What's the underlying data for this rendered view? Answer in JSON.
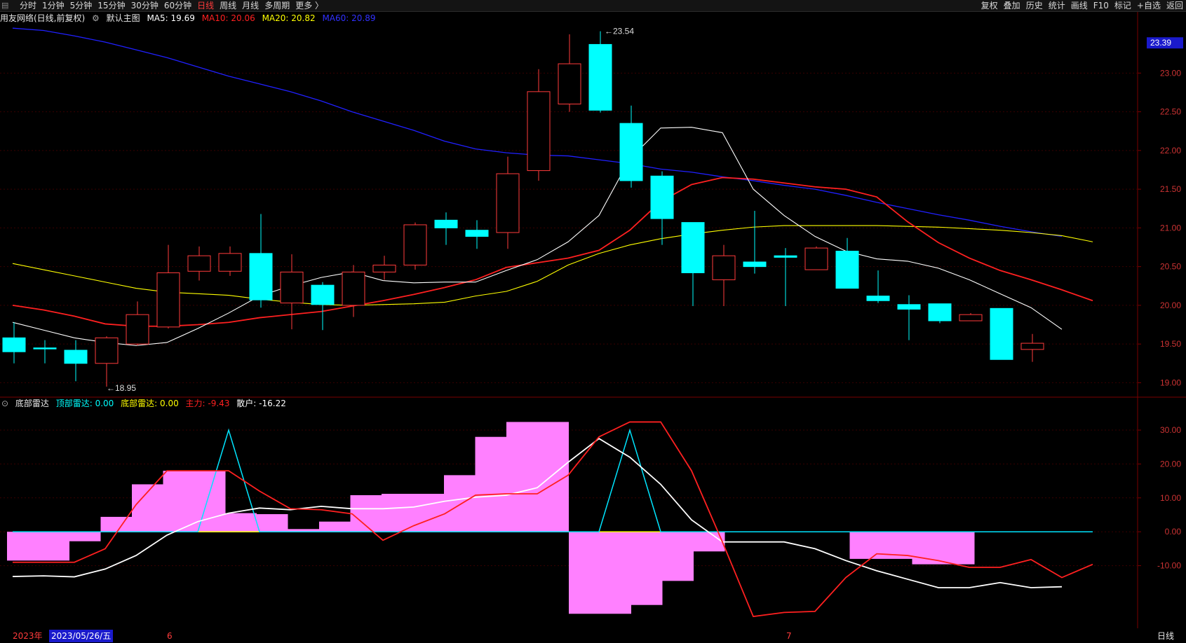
{
  "toolbar": {
    "left_items": [
      "分时",
      "1分钟",
      "5分钟",
      "15分钟",
      "30分钟",
      "60分钟",
      "日线",
      "周线",
      "月线",
      "多周期",
      "更多 〉"
    ],
    "active_item": "日线",
    "right_items": [
      "复权",
      "叠加",
      "历史",
      "统计",
      "画线",
      "F10",
      "标记",
      "+自选",
      "返回"
    ]
  },
  "main_info": {
    "stock": "用友网络(日线,前复权)",
    "template": "默认主图",
    "ma5_label": "MA5: 19.69",
    "ma10_label": "MA10: 20.06",
    "ma20_label": "MA20: 20.82",
    "ma60_label": "MA60: 20.89"
  },
  "indicator_info": {
    "name": "底部雷达",
    "top_label": "顶部雷达: 0.00",
    "bottom_label": "底部雷达: 0.00",
    "main_label": "主力: -9.43",
    "retail_label": "散户: -16.22"
  },
  "annotations": {
    "high": "23.54",
    "low": "18.95",
    "last_price": "23.39"
  },
  "date_bar": {
    "year": "2023年",
    "selected_date": "2023/05/26/五",
    "month_june": "6",
    "month_july": "7",
    "period": "日线"
  },
  "colors": {
    "up": "#ff3b3b",
    "down": "#00ffff",
    "ma5": "#ffffff",
    "ma10": "#ff2020",
    "ma20": "#ffff00",
    "ma60": "#2020ff",
    "hist": "#ff80ff"
  },
  "chart_data": [
    {
      "type": "candlestick",
      "ylim": [
        18.85,
        23.6
      ],
      "y_ticks": [
        "19.00",
        "19.50",
        "20.00",
        "20.50",
        "21.00",
        "21.50",
        "22.00",
        "22.50",
        "23.00"
      ],
      "candles": [
        {
          "o": 19.58,
          "h": 19.78,
          "l": 19.25,
          "c": 19.4
        },
        {
          "o": 19.45,
          "h": 19.55,
          "l": 19.25,
          "c": 19.44
        },
        {
          "o": 19.42,
          "h": 19.55,
          "l": 19.02,
          "c": 19.25
        },
        {
          "o": 19.25,
          "h": 19.6,
          "l": 18.95,
          "c": 19.58
        },
        {
          "o": 19.5,
          "h": 20.05,
          "l": 19.48,
          "c": 19.88
        },
        {
          "o": 19.72,
          "h": 20.78,
          "l": 19.7,
          "c": 20.42
        },
        {
          "o": 20.44,
          "h": 20.76,
          "l": 20.32,
          "c": 20.64
        },
        {
          "o": 20.44,
          "h": 20.76,
          "l": 20.38,
          "c": 20.67
        },
        {
          "o": 20.67,
          "h": 21.18,
          "l": 19.97,
          "c": 20.07
        },
        {
          "o": 20.03,
          "h": 20.66,
          "l": 19.69,
          "c": 20.43
        },
        {
          "o": 20.26,
          "h": 20.3,
          "l": 19.68,
          "c": 20.01
        },
        {
          "o": 20.0,
          "h": 20.52,
          "l": 19.85,
          "c": 20.43
        },
        {
          "o": 20.43,
          "h": 20.64,
          "l": 20.33,
          "c": 20.52
        },
        {
          "o": 20.52,
          "h": 21.07,
          "l": 20.46,
          "c": 21.04
        },
        {
          "o": 21.1,
          "h": 21.2,
          "l": 20.78,
          "c": 21.0
        },
        {
          "o": 20.97,
          "h": 21.1,
          "l": 20.73,
          "c": 20.89
        },
        {
          "o": 20.94,
          "h": 21.92,
          "l": 20.73,
          "c": 21.7
        },
        {
          "o": 21.74,
          "h": 23.05,
          "l": 21.61,
          "c": 22.76
        },
        {
          "o": 22.6,
          "h": 23.5,
          "l": 22.5,
          "c": 23.12
        },
        {
          "o": 23.37,
          "h": 23.54,
          "l": 22.49,
          "c": 22.52
        },
        {
          "o": 22.35,
          "h": 22.58,
          "l": 21.52,
          "c": 21.61
        },
        {
          "o": 21.67,
          "h": 21.73,
          "l": 20.78,
          "c": 21.12
        },
        {
          "o": 21.07,
          "h": 21.07,
          "l": 19.99,
          "c": 20.42
        },
        {
          "o": 20.33,
          "h": 20.78,
          "l": 19.99,
          "c": 20.64
        },
        {
          "o": 20.56,
          "h": 21.22,
          "l": 20.41,
          "c": 20.5
        },
        {
          "o": 20.64,
          "h": 20.74,
          "l": 19.99,
          "c": 20.62
        },
        {
          "o": 20.46,
          "h": 20.76,
          "l": 20.46,
          "c": 20.74
        },
        {
          "o": 20.7,
          "h": 20.87,
          "l": 20.22,
          "c": 20.22
        },
        {
          "o": 20.12,
          "h": 20.45,
          "l": 20.03,
          "c": 20.06
        },
        {
          "o": 20.01,
          "h": 20.13,
          "l": 19.55,
          "c": 19.95
        },
        {
          "o": 20.02,
          "h": 20.02,
          "l": 19.77,
          "c": 19.8
        },
        {
          "o": 19.8,
          "h": 19.9,
          "l": 19.8,
          "c": 19.88
        },
        {
          "o": 19.96,
          "h": 19.96,
          "l": 19.3,
          "c": 19.3
        },
        {
          "o": 19.43,
          "h": 19.63,
          "l": 19.27,
          "c": 19.51
        }
      ],
      "ma5": [
        19.78,
        19.68,
        19.58,
        19.52,
        19.48,
        19.52,
        19.7,
        19.9,
        20.12,
        20.25,
        20.36,
        20.43,
        20.32,
        20.29,
        20.3,
        20.3,
        20.45,
        20.59,
        20.82,
        21.16,
        21.89,
        22.29,
        22.3,
        22.23,
        21.5,
        21.16,
        20.89,
        20.7,
        20.6,
        20.57,
        20.48,
        20.33,
        20.15,
        19.97,
        19.69
      ],
      "ma10": [
        20.0,
        19.94,
        19.86,
        19.76,
        19.73,
        19.73,
        19.75,
        19.78,
        19.84,
        19.88,
        19.92,
        19.99,
        20.06,
        20.14,
        20.23,
        20.33,
        20.49,
        20.55,
        20.61,
        20.71,
        20.97,
        21.34,
        21.56,
        21.65,
        21.63,
        21.58,
        21.53,
        21.5,
        21.4,
        21.08,
        20.81,
        20.61,
        20.45,
        20.33,
        20.2,
        20.06
      ],
      "ma20": [
        20.54,
        20.46,
        20.38,
        20.3,
        20.22,
        20.17,
        20.15,
        20.13,
        20.08,
        20.04,
        20.01,
        20.0,
        20.01,
        20.02,
        20.04,
        20.12,
        20.18,
        20.31,
        20.52,
        20.67,
        20.78,
        20.86,
        20.92,
        20.97,
        21.01,
        21.03,
        21.03,
        21.03,
        21.03,
        21.02,
        21.01,
        20.99,
        20.97,
        20.94,
        20.9,
        20.82
      ],
      "ma60": [
        23.58,
        23.55,
        23.48,
        23.4,
        23.3,
        23.2,
        23.08,
        22.96,
        22.86,
        22.76,
        22.64,
        22.5,
        22.38,
        22.26,
        22.12,
        22.02,
        21.97,
        21.94,
        21.93,
        21.88,
        21.83,
        21.76,
        21.72,
        21.66,
        21.61,
        21.55,
        21.5,
        21.42,
        21.33,
        21.25,
        21.17,
        21.1,
        21.02,
        20.95,
        20.89
      ]
    },
    {
      "type": "bar",
      "ylim": [
        -26,
        36
      ],
      "y_ticks": [
        "30.00",
        "20.00",
        "10.00",
        "0.00",
        "-10.00"
      ],
      "hist": [
        -8.5,
        -8.5,
        -2.8,
        4.4,
        14.0,
        18.0,
        18.0,
        5.5,
        5.2,
        0.8,
        3.0,
        10.8,
        11.2,
        11.2,
        16.7,
        28.0,
        32.4,
        32.4,
        -24.2,
        -24.2,
        -21.6,
        -14.5,
        -5.8,
        0,
        0,
        0,
        0,
        -8.0,
        -8.0,
        -9.6,
        -9.6
      ],
      "main_line": [
        -9.0,
        -9.0,
        -9.0,
        -5.0,
        8.0,
        18.0,
        18.0,
        18.0,
        12.0,
        6.8,
        6.5,
        5.3,
        -2.5,
        1.8,
        5.3,
        10.8,
        11.2,
        11.2,
        16.7,
        28.0,
        32.4,
        32.4,
        18.0,
        -3.0,
        -25.0,
        -23.8,
        -23.5,
        -13.5,
        -6.5,
        -7.0,
        -8.5,
        -10.5,
        -10.5,
        -8.2,
        -13.5,
        -9.6
      ],
      "retail_line": [
        -13.2,
        -13.0,
        -13.3,
        -11.0,
        -7.0,
        -1.0,
        3.0,
        5.5,
        7.0,
        6.5,
        7.5,
        6.8,
        6.8,
        7.3,
        9.0,
        10.2,
        10.8,
        13.0,
        20.5,
        27.5,
        22.0,
        14.0,
        3.5,
        -3.0,
        -3.0,
        -3.0,
        -5.0,
        -8.5,
        -11.5,
        -14.0,
        -16.5,
        -16.5,
        -15.0,
        -16.5,
        -16.22
      ],
      "top_signal": [
        0,
        0,
        0,
        0,
        0,
        0,
        0,
        30.0,
        0,
        0,
        0,
        0,
        0,
        0,
        0,
        0,
        0,
        0,
        0,
        0,
        30.0,
        0,
        0,
        0,
        0,
        0,
        0,
        0,
        0,
        0,
        0,
        0,
        0,
        0,
        0,
        0
      ]
    }
  ]
}
